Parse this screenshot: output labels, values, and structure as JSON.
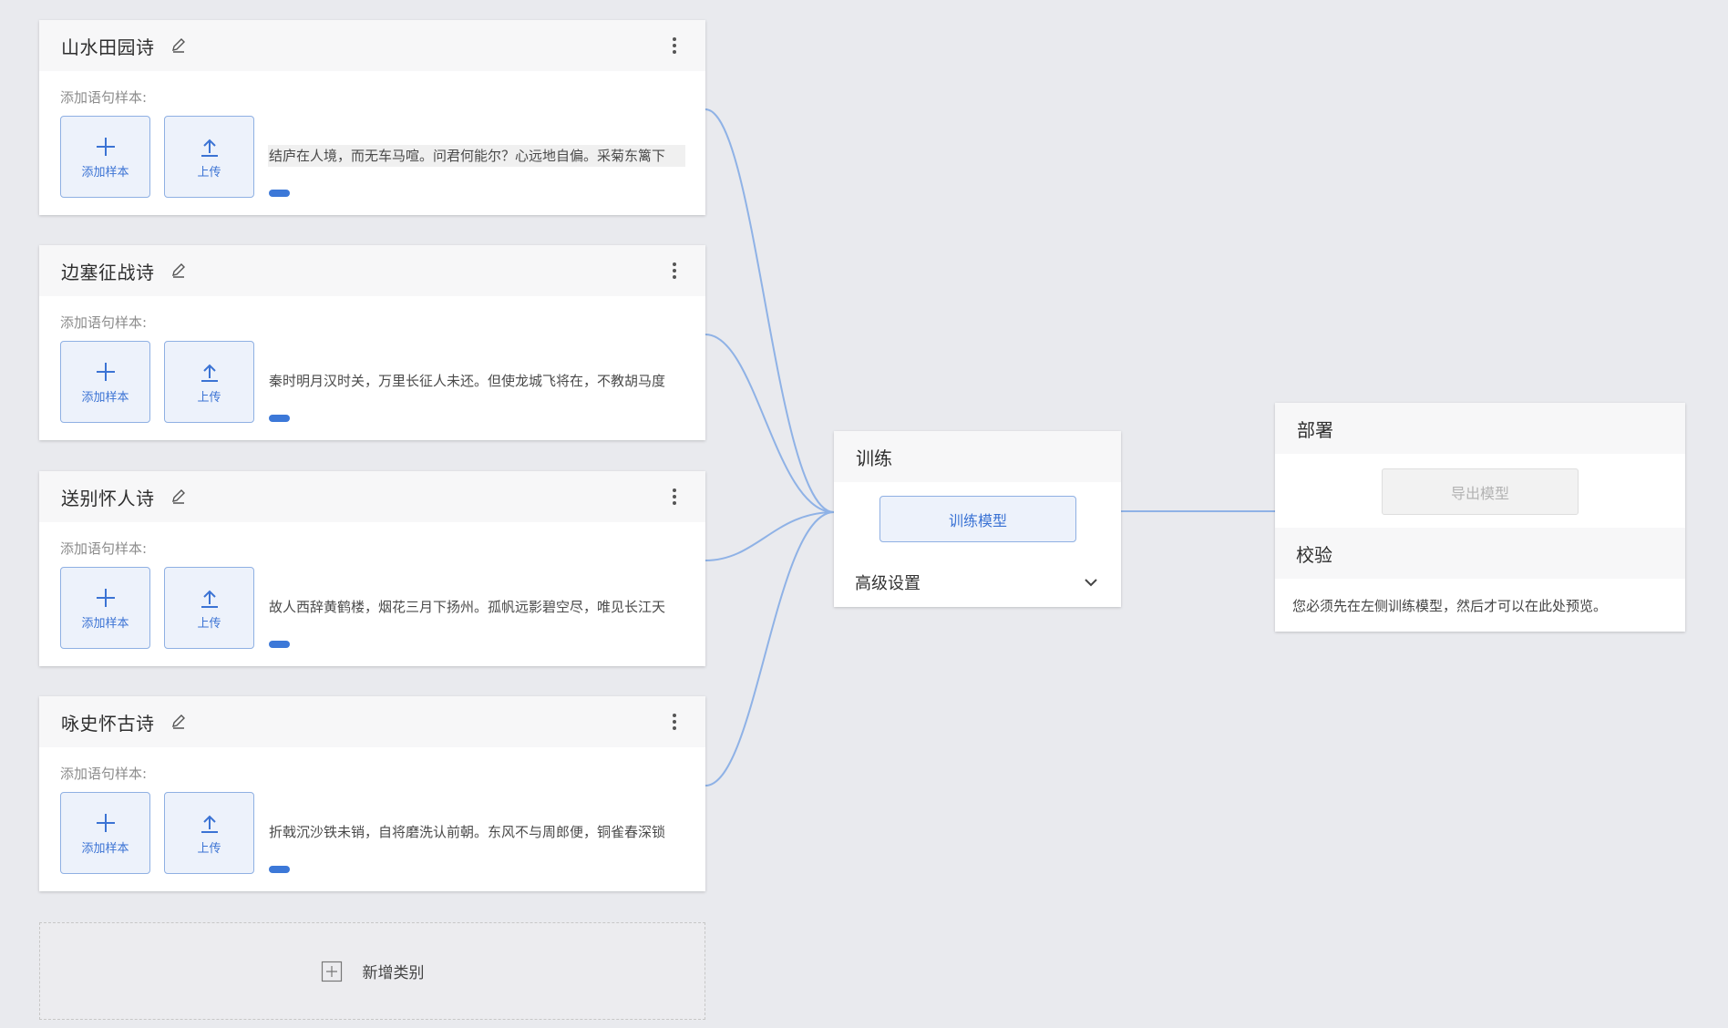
{
  "categories": [
    {
      "title": "山水田园诗",
      "sample_label": "添加语句样本:",
      "add_label": "添加样本",
      "upload_label": "上传",
      "sample_text": "结庐在人境，而无车马喧。问君何能尔？心远地自偏。采菊东篱下"
    },
    {
      "title": "边塞征战诗",
      "sample_label": "添加语句样本:",
      "add_label": "添加样本",
      "upload_label": "上传",
      "sample_text": "秦时明月汉时关，万里长征人未还。但使龙城飞将在，不教胡马度"
    },
    {
      "title": "送别怀人诗",
      "sample_label": "添加语句样本:",
      "add_label": "添加样本",
      "upload_label": "上传",
      "sample_text": "故人西辞黄鹤楼，烟花三月下扬州。孤帆远影碧空尽，唯见长江天"
    },
    {
      "title": "咏史怀古诗",
      "sample_label": "添加语句样本:",
      "add_label": "添加样本",
      "upload_label": "上传",
      "sample_text": "折戟沉沙铁未销，自将磨洗认前朝。东风不与周郎便，铜雀春深锁"
    }
  ],
  "add_category": {
    "label": "新增类别"
  },
  "train": {
    "title": "训练",
    "button_label": "训练模型",
    "advanced_label": "高级设置"
  },
  "deploy": {
    "title": "部署",
    "export_label": "导出模型"
  },
  "validate": {
    "title": "校验",
    "note": "您必须先在左侧训练模型，然后才可以在此处预览。"
  },
  "colors": {
    "accent": "#3c78d8",
    "connector": "#8fb2e6",
    "background": "#e9eaee"
  }
}
